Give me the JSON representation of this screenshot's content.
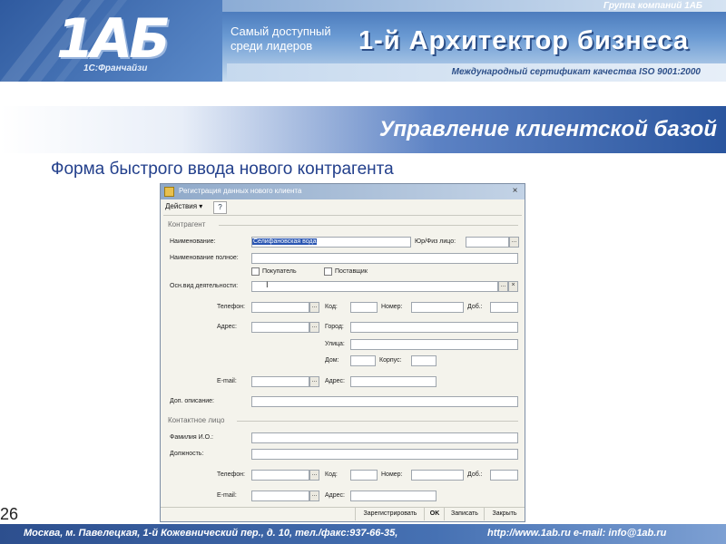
{
  "header": {
    "group": "Группа компаний 1АБ",
    "logo": "1АБ",
    "franchise": "1С:Франчайзи",
    "slogan": "Самый доступный среди лидеров",
    "brand": "1-й Архитектор бизнеса",
    "certificate": "Международный сертификат качества ISO 9001:2000"
  },
  "title": "Управление клиентской базой",
  "subtitle": "Форма быстрого ввода нового контрагента",
  "page_number": "26",
  "footer": {
    "address": "Москва, м. Павелецкая, 1-й Кожевнический пер., д. 10, тел./факс:937-66-35,",
    "contacts": "http://www.1ab.ru    e-mail: info@1ab.ru"
  },
  "dialog": {
    "title": "Регистрация данных нового клиента",
    "close": "×",
    "menu": "Действия ▾",
    "help": "?",
    "section_contractor": "Контрагент",
    "section_contact": "Контактное лицо",
    "labels": {
      "name": "Наименование:",
      "legal": "Юр/Физ лицо:",
      "full_name": "Наименование полное:",
      "buyer": "Покупатель",
      "supplier": "Поставщик",
      "activity": "Осн.вид деятельности:",
      "phone": "Телефон:",
      "code": "Код:",
      "number": "Номер:",
      "ext": "Доб.:",
      "address": "Адрес:",
      "city": "Город:",
      "street": "Улица:",
      "house": "Дом:",
      "building": "Корпус:",
      "email": "E-mail:",
      "email_address": "Адрес:",
      "description": "Доп. описание:",
      "fio": "Фамилия И.О.:",
      "position": "Должность:",
      "phone2": "Телефон:",
      "code2": "Код:",
      "number2": "Номер:",
      "ext2": "Доб.:",
      "email2": "E-mail:",
      "email_address2": "Адрес:"
    },
    "values": {
      "name": "Селифановская вода"
    },
    "dd": "...",
    "clear": "×",
    "buttons": {
      "register": "Зарегистрировать",
      "ok": "OK",
      "save": "Записать",
      "close": "Закрыть"
    }
  }
}
